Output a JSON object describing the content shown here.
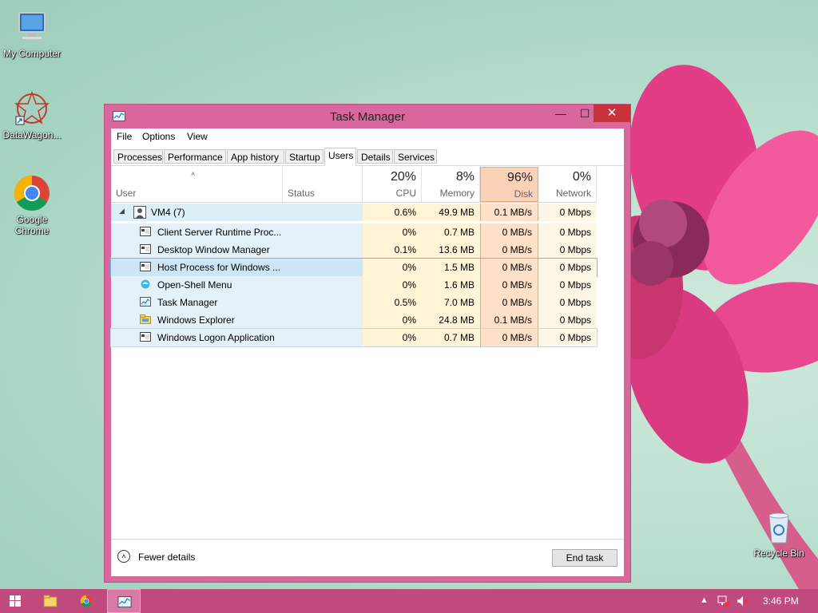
{
  "desktop": {
    "icons": [
      {
        "label": "My Computer"
      },
      {
        "label": "DataWagon..."
      },
      {
        "label": "Google Chrome"
      },
      {
        "label": "Recycle Bin"
      }
    ]
  },
  "window": {
    "title": "Task Manager",
    "controls": {
      "minimize": "—",
      "maximize": "☐",
      "close": "✕"
    },
    "menu": [
      "File",
      "Options",
      "View"
    ],
    "tabs": [
      "Processes",
      "Performance",
      "App history",
      "Startup",
      "Users",
      "Details",
      "Services"
    ],
    "active_tab": "Users",
    "columns": {
      "user": "User",
      "status": "Status",
      "cpu": {
        "pct": "20%",
        "label": "CPU"
      },
      "memory": {
        "pct": "8%",
        "label": "Memory"
      },
      "disk": {
        "pct": "96%",
        "label": "Disk"
      },
      "network": {
        "pct": "0%",
        "label": "Network"
      }
    },
    "group": {
      "name": "VM4 (7)",
      "cpu": "0.6%",
      "memory": "49.9 MB",
      "disk": "0.1 MB/s",
      "network": "0 Mbps"
    },
    "rows": [
      {
        "name": "Client Server Runtime Proc...",
        "cpu": "0%",
        "memory": "0.7 MB",
        "disk": "0 MB/s",
        "network": "0 Mbps",
        "icon": "window-icon"
      },
      {
        "name": "Desktop Window Manager",
        "cpu": "0.1%",
        "memory": "13.6 MB",
        "disk": "0 MB/s",
        "network": "0 Mbps",
        "icon": "window-icon"
      },
      {
        "name": "Host Process for Windows ...",
        "cpu": "0%",
        "memory": "1.5 MB",
        "disk": "0 MB/s",
        "network": "0 Mbps",
        "icon": "window-icon"
      },
      {
        "name": "Open-Shell Menu",
        "cpu": "0%",
        "memory": "1.6 MB",
        "disk": "0 MB/s",
        "network": "0 Mbps",
        "icon": "shell-icon"
      },
      {
        "name": "Task Manager",
        "cpu": "0.5%",
        "memory": "7.0 MB",
        "disk": "0 MB/s",
        "network": "0 Mbps",
        "icon": "taskmgr-icon"
      },
      {
        "name": "Windows Explorer",
        "cpu": "0%",
        "memory": "24.8 MB",
        "disk": "0.1 MB/s",
        "network": "0 Mbps",
        "icon": "folder-icon"
      },
      {
        "name": "Windows Logon Application",
        "cpu": "0%",
        "memory": "0.7 MB",
        "disk": "0 MB/s",
        "network": "0 Mbps",
        "icon": "window-icon"
      }
    ],
    "footer": {
      "fewer_details": "Fewer details",
      "end_task": "End task"
    }
  },
  "taskbar": {
    "clock": "3:46 PM",
    "apps": [
      "start-icon",
      "file-explorer-icon",
      "chrome-icon",
      "task-manager-icon"
    ]
  },
  "colors": {
    "accent": "#d8689c",
    "taskbar": "#c0497e",
    "close": "#c7323b",
    "disk_highlight": "#fbd2b8"
  }
}
